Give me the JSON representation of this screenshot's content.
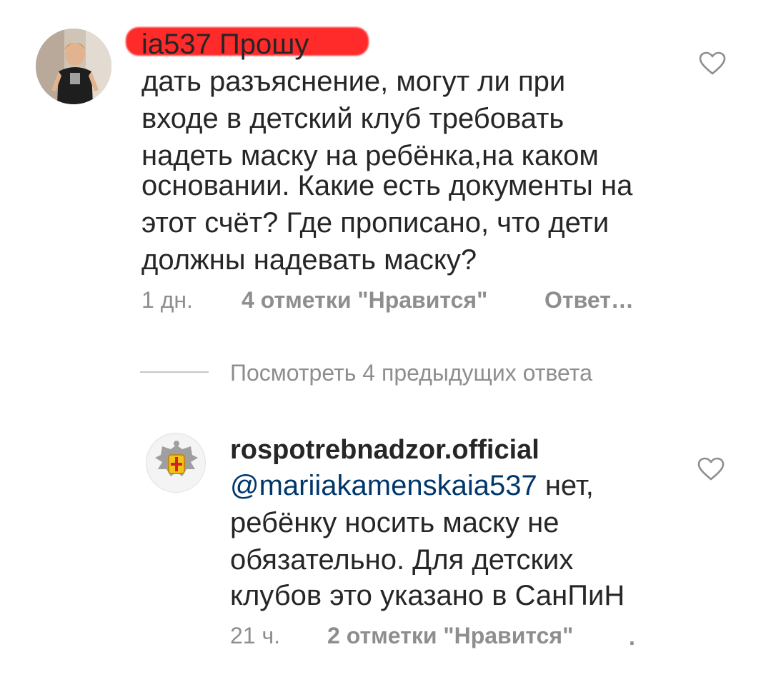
{
  "comment": {
    "username_visible_suffix": "ia537",
    "lines": [
      "Прошу",
      "дать разъяснение, могут ли при",
      "входе в детский клуб требовать",
      "надеть маску на ребёнка,на каком",
      "основании. Какие есть документы на",
      "этот счёт? Где прописано, что дети",
      "должны надевать маску?"
    ],
    "time": "1 дн.",
    "likes": "4 отметки \"Нравится\"",
    "reply": "Ответ…",
    "like_icon": "heart-outline-icon"
  },
  "view_replies": "Посмотреть 4 предыдущих ответа",
  "reply": {
    "username": "rospotrebnadzor.official",
    "mention": "@mariiakamenskaia537",
    "lines": [
      "нет,",
      "ребёнку носить маску не",
      "обязательно. Для детских",
      "клубов это указано в СанПиН"
    ],
    "time": "21 ч.",
    "likes": "2 отметки \"Нравится\"",
    "trailing": ".",
    "like_icon": "heart-outline-icon"
  },
  "colors": {
    "text": "#262626",
    "meta": "#8e8e8e",
    "mention": "#00376b",
    "redaction": "#ff2a2a"
  }
}
